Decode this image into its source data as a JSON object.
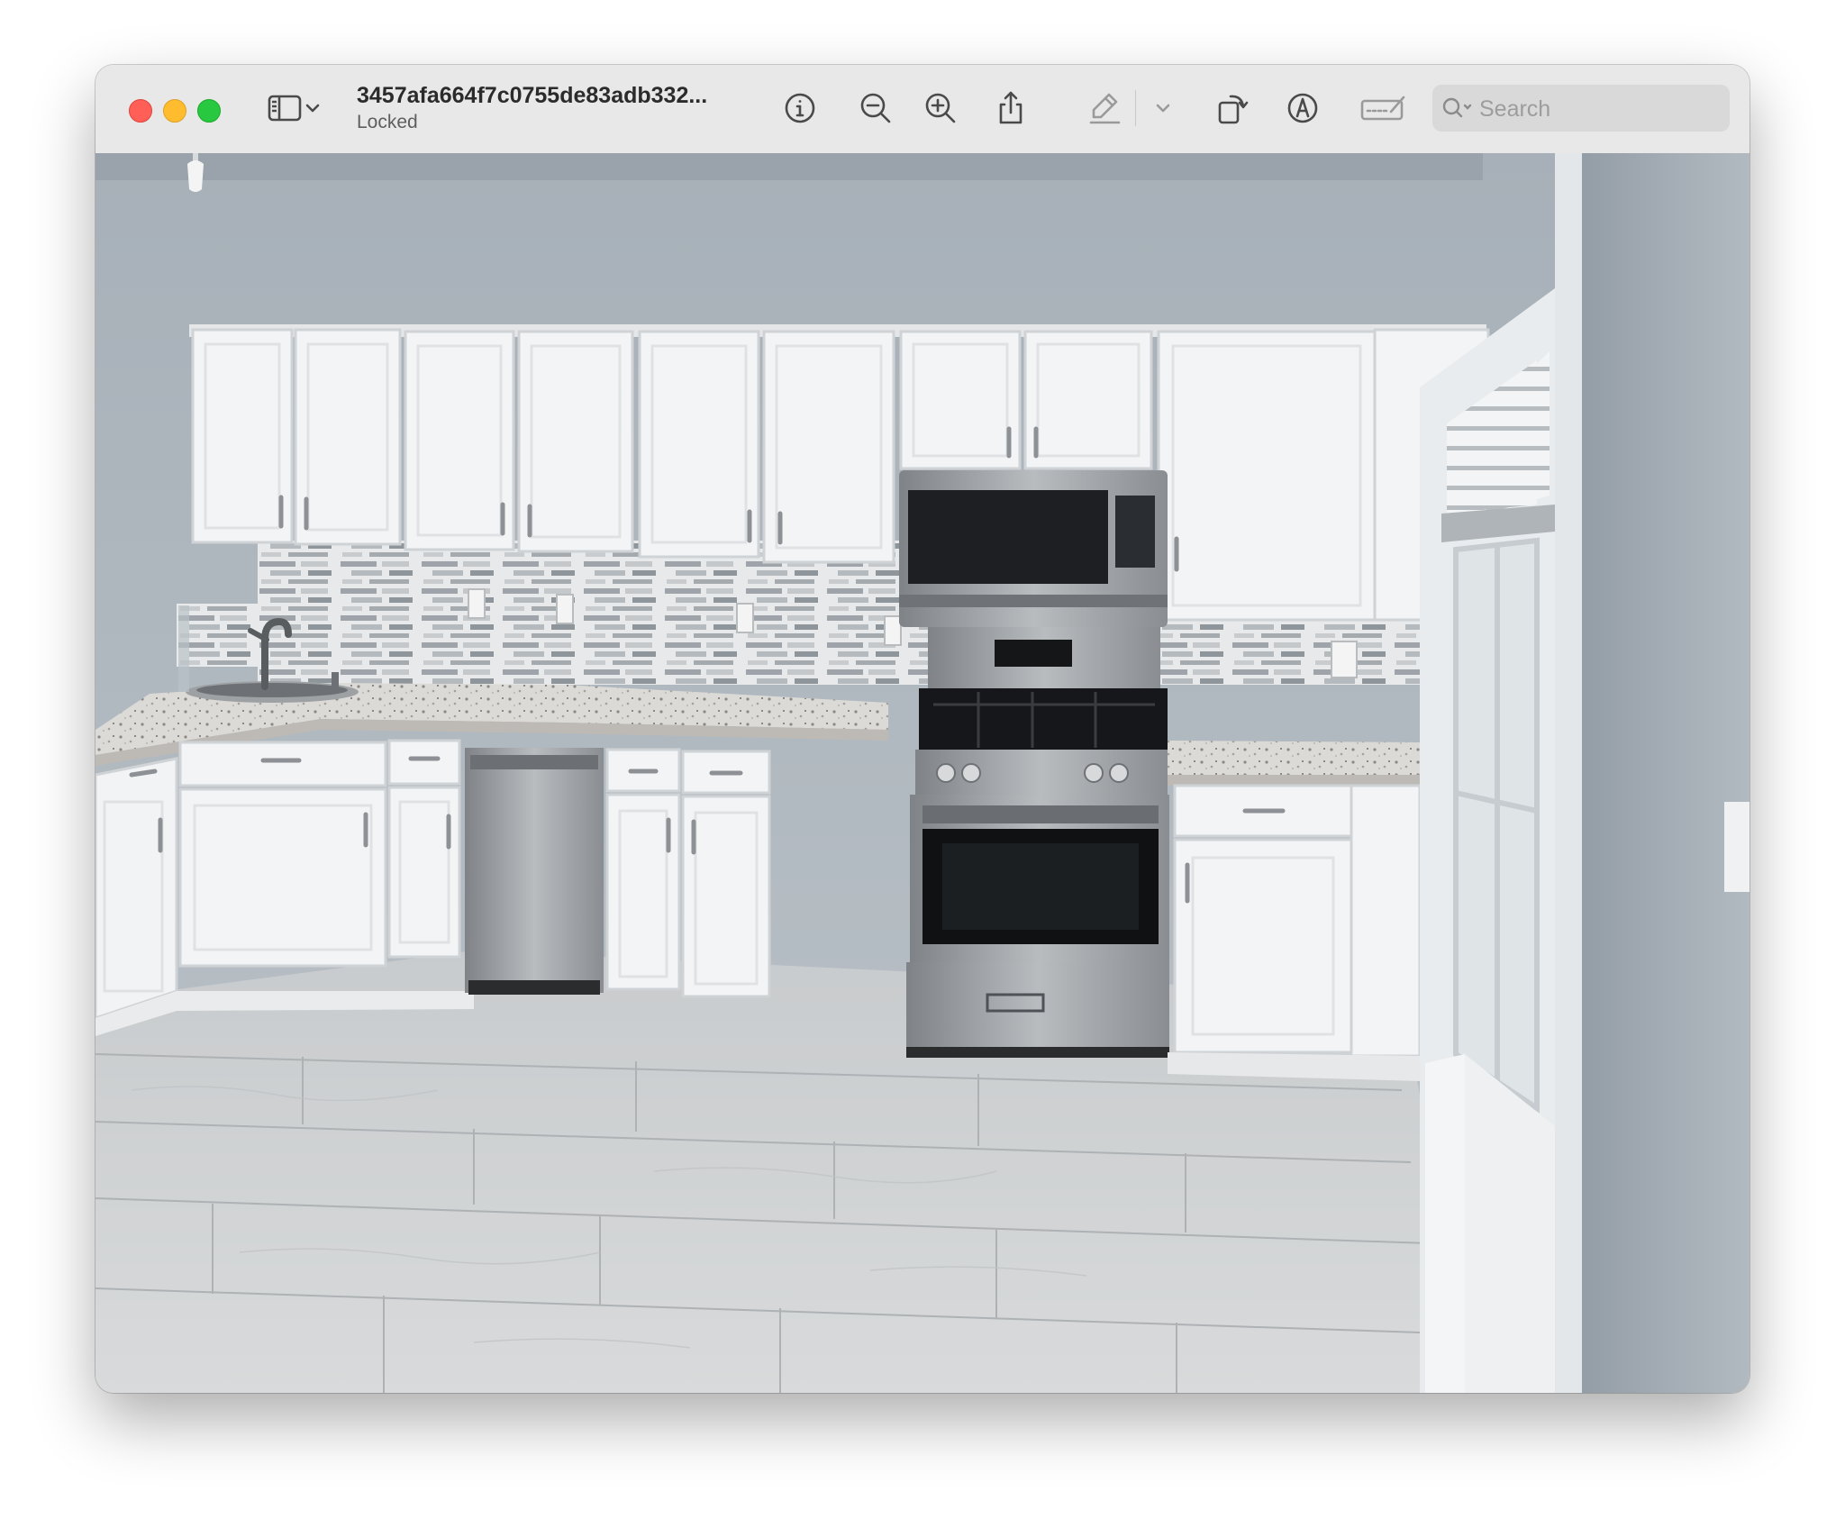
{
  "window": {
    "title": "3457afa664f7c0755de83adb332...",
    "subtitle": "Locked"
  },
  "toolbar": {
    "icons": [
      "sidebar-icon",
      "chevron-down-icon",
      "info-icon",
      "zoom-out-icon",
      "zoom-in-icon",
      "share-icon",
      "highlight-pen-icon",
      "chevron-down-icon",
      "rotate-icon",
      "markup-icon",
      "signature-icon",
      "search-icon"
    ]
  },
  "search": {
    "placeholder": "Search"
  },
  "photo": {
    "subject": "kitchen-photo"
  },
  "colors": {
    "close": "#ff5f57",
    "minimize": "#febc2e",
    "zoom": "#28c840",
    "toolbar": "#e8e8e8",
    "wall": "#a8b2bb",
    "cabinet": "#f4f5f6",
    "steel": "#8e9195",
    "floor": "#cfd2d4"
  }
}
